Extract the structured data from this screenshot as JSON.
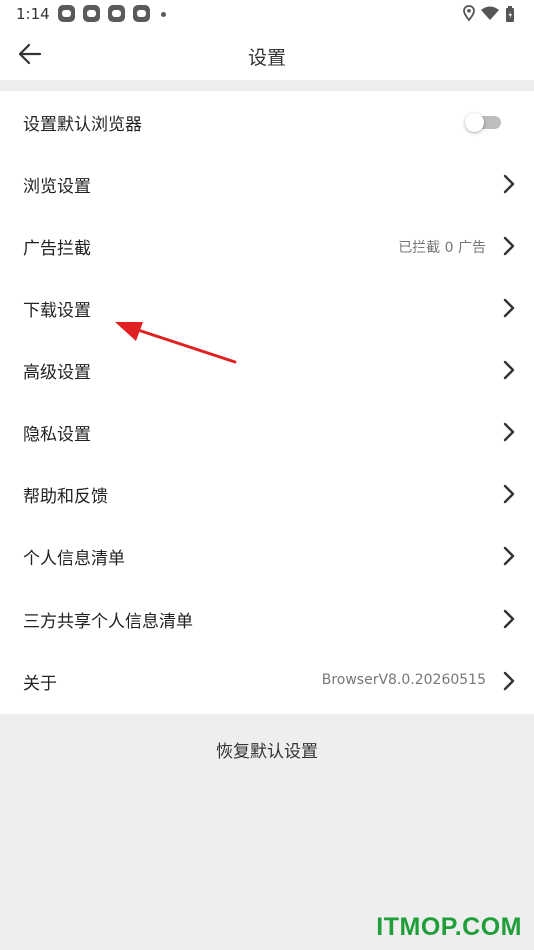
{
  "status_bar": {
    "time": "1:14",
    "notification_icons": [
      "app-notification-icon",
      "app-notification-icon",
      "app-notification-icon",
      "app-notification-icon"
    ],
    "system_icons": [
      "location-icon",
      "wifi-icon",
      "battery-icon"
    ]
  },
  "app_bar": {
    "back_icon": "back-arrow-icon",
    "title": "设置"
  },
  "settings": {
    "default_browser": {
      "label": "设置默认浏览器",
      "toggle_on": false
    },
    "browse": {
      "label": "浏览设置"
    },
    "ad_block": {
      "label": "广告拦截",
      "value": "已拦截 0 广告"
    },
    "download": {
      "label": "下载设置"
    },
    "advanced": {
      "label": "高级设置"
    },
    "privacy": {
      "label": "隐私设置"
    },
    "help": {
      "label": "帮助和反馈"
    },
    "personal_info": {
      "label": "个人信息清单"
    },
    "third_party_info": {
      "label": "三方共享个人信息清单"
    },
    "about": {
      "label": "关于",
      "value": "BrowserV8.0.20260515"
    }
  },
  "reset_label": "恢复默认设置",
  "watermark": "ITMOP.COM",
  "colors": {
    "annotation_arrow": "#e02020",
    "watermark": "#1f9e3a",
    "toggle_off_track": "#bdbdbd",
    "background": "#eeeeee"
  }
}
